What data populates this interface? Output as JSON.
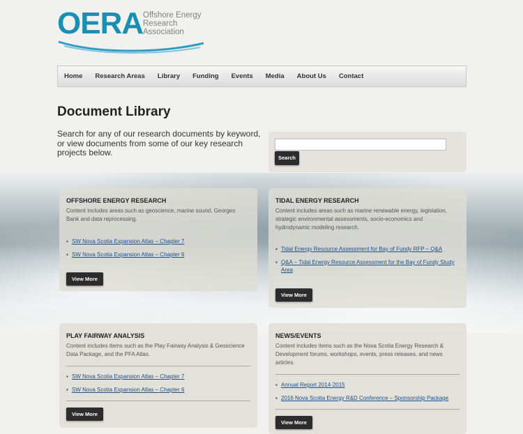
{
  "logo": {
    "wordmark": "OERA",
    "lines": [
      "Offshore Energy",
      "Research",
      "Association"
    ],
    "brand_color": "#1a8fb0"
  },
  "nav": {
    "items": [
      "Home",
      "Research Areas",
      "Library",
      "Funding",
      "Events",
      "Media",
      "About Us",
      "Contact"
    ]
  },
  "page": {
    "title": "Document Library",
    "intro": "Search for any of our research documents by keyword, or view documents from some of our key research projects below."
  },
  "search": {
    "value": "",
    "button": "Search"
  },
  "cards": [
    {
      "title": "OFFSHORE ENERGY RESEARCH",
      "desc": "Content includes areas such as geoscience, marine sound, Georges Bank and data reprocessing.",
      "links": [
        "SW Nova Scotia Expansion Atlas – Chapter 7",
        "SW Nova Scotia Expansion Atlas – Chapter 6"
      ],
      "button": "View More"
    },
    {
      "title": "TIDAL ENERGY RESEARCH",
      "desc": "Content includes areas such as marine renewable energy, legislation, strategic environmental assessments, socio-economics and hydrodynamic modeling research.",
      "links": [
        "Tidal Energy Resource Assessment for Bay of Fundy RFP – Q&A",
        "Q&A – Tidal Energy Resource Assessment for the Bay of Fundy Study Area"
      ],
      "button": "View More"
    },
    {
      "title": "PLAY FAIRWAY ANALYSIS",
      "desc": "Content includes items such as the Play Fairway Analysis & Geoscience Data Package, and the PFA Atlas.",
      "links": [
        "SW Nova Scotia Expansion Atlas – Chapter 7",
        "SW Nova Scotia Expansion Atlas – Chapter 6"
      ],
      "button": "View More"
    },
    {
      "title": "NEWS/EVENTS",
      "desc": "Content includes items such as the Nova Scotia Energy Research & Development forums, workshops, events, press releases, and news articles.",
      "links": [
        "Annual Report 2014-2015",
        "2016 Nova Scotia Energy R&D Conference – Sponsorship Package"
      ],
      "button": "View More"
    }
  ]
}
